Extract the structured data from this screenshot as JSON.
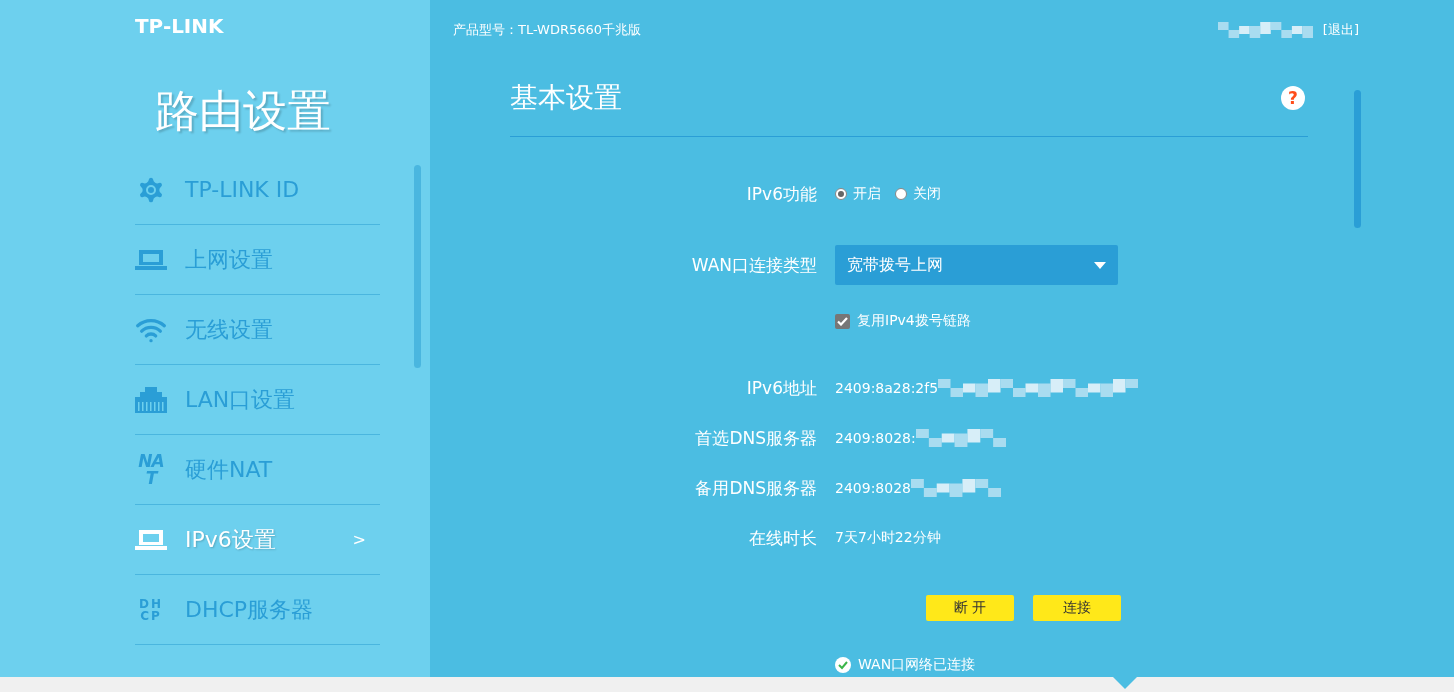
{
  "header": {
    "logo": "TP-LINK",
    "product": "产品型号：TL-WDR5660千兆版",
    "user_redacted": true,
    "logout": "[退出]"
  },
  "sidebar": {
    "title": "路由设置",
    "items": [
      {
        "label": "TP-LINK ID",
        "selected": false
      },
      {
        "label": "上网设置",
        "selected": false
      },
      {
        "label": "无线设置",
        "selected": false
      },
      {
        "label": "LAN口设置",
        "selected": false
      },
      {
        "label": "硬件NAT",
        "icon_text": "NAT",
        "selected": false
      },
      {
        "label": "IPv6设置",
        "selected": true,
        "arrow": ">"
      },
      {
        "label": "DHCP服务器",
        "icon_text": "DH CP",
        "selected": false
      }
    ]
  },
  "section": {
    "title": "基本设置",
    "help": "?"
  },
  "form": [
    {
      "kind": "radio",
      "label": "IPv6功能",
      "options": [
        {
          "label": "开启",
          "selected": true
        },
        {
          "label": "关闭",
          "selected": false
        }
      ]
    },
    {
      "kind": "select",
      "label": "WAN口连接类型",
      "value": "宽带拨号上网"
    },
    {
      "kind": "checkbox",
      "text": "复用IPv4拨号链路",
      "checked": true
    },
    {
      "kind": "info",
      "label": "IPv6地址",
      "value": "2409:8a28:2f5",
      "redacted": true
    },
    {
      "kind": "info",
      "label": "首选DNS服务器",
      "value": "2409:8028:",
      "redacted": true
    },
    {
      "kind": "info",
      "label": "备用DNS服务器",
      "value": "2409:8028",
      "redacted": true
    },
    {
      "kind": "info",
      "label": "在线时长",
      "value": "7天7小时22分钟",
      "redacted": false
    }
  ],
  "buttons": [
    "断 开",
    "连接"
  ],
  "status": {
    "text": "WAN口网络已连接",
    "connected": true
  }
}
